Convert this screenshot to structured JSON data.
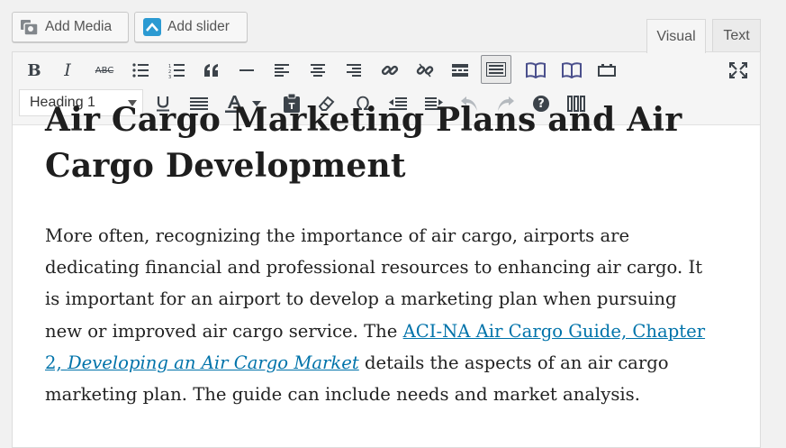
{
  "media_buttons": {
    "add_media": "Add Media",
    "add_slider": "Add slider",
    "add_media_icon": "media-camera-icon",
    "add_slider_icon": "slider-icon"
  },
  "editor_tabs": {
    "visual": "Visual",
    "text": "Text",
    "active": "Visual"
  },
  "toolbar": {
    "row1": [
      "bold",
      "italic",
      "strikethrough",
      "bulleted-list",
      "numbered-list",
      "blockquote",
      "horizontal-line",
      "align-left",
      "align-center",
      "align-right",
      "insert-link",
      "remove-link",
      "insert-more",
      "toolbar-toggle",
      "book",
      "book",
      "page-break",
      "fullscreen"
    ],
    "row2": [
      "format-select",
      "underline",
      "justify",
      "text-color",
      "paste-as-text",
      "clear-formatting",
      "special-character",
      "outdent",
      "indent",
      "undo",
      "redo",
      "help",
      "columns"
    ],
    "bold_label": "B",
    "italic_label": "I",
    "strike_label": "ABC",
    "format_value": "Heading 1",
    "omega_label": "Ω",
    "help_label": "?"
  },
  "content": {
    "heading": "Air Cargo Marketing Plans and Air Cargo Development",
    "para_before_link": "More often, recognizing the importance of air cargo, airports are dedicating financial and professional resources to enhancing air cargo. It is important for an airport to develop a marketing plan when pursuing new or improved air cargo service. The ",
    "link_text": "ACI-NA Air Cargo Guide, Chapter 2, ",
    "link_italic": "Developing an Air Cargo Market",
    "para_after_link": " details the aspects of an air cargo marketing plan. The guide can include needs and market analysis."
  },
  "colors": {
    "link": "#0073aa",
    "toolbar_bg": "#f5f5f5",
    "page_bg": "#f1f1f1"
  }
}
